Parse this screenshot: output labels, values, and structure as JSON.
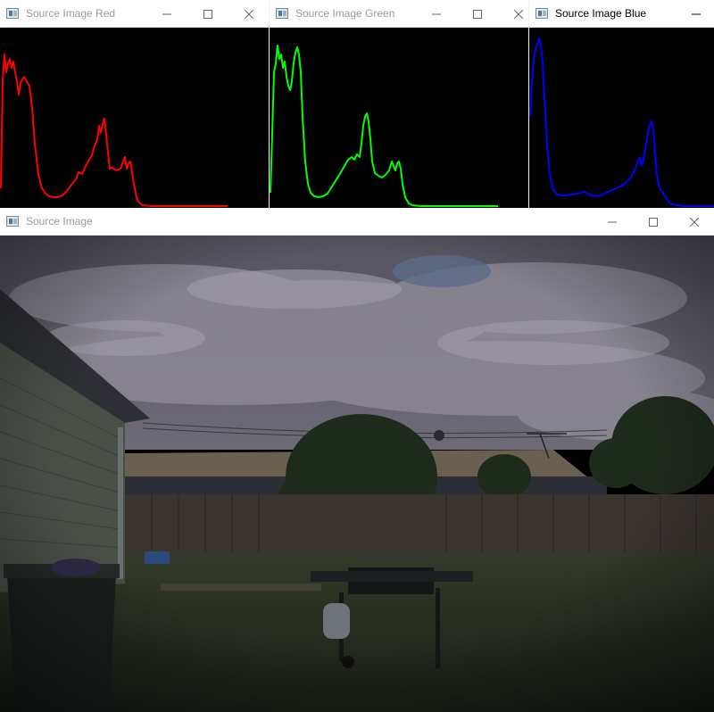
{
  "windows": {
    "red": {
      "title": "Source Image Red",
      "active": false,
      "color": "#ff0000"
    },
    "green": {
      "title": "Source Image Green",
      "active": false,
      "color": "#00ff00"
    },
    "blue": {
      "title": "Source Image Blue",
      "active": true,
      "color": "#0000ff"
    },
    "source": {
      "title": "Source Image",
      "active": false
    }
  },
  "icons": {
    "app": "opencv-window-icon",
    "minimize": "minimize-icon",
    "maximize": "maximize-icon",
    "close": "close-icon"
  },
  "scene": {
    "description_colors": {
      "sky": "#5d5b66",
      "cloud": "#8d8a96",
      "roof": "#6b6150",
      "fence": "#3a342f",
      "tree": "#1f2a1c",
      "grass": "#252b1f",
      "house": "#4a5048",
      "bbq": "#151617",
      "bin": "#1a1f1d"
    }
  }
}
